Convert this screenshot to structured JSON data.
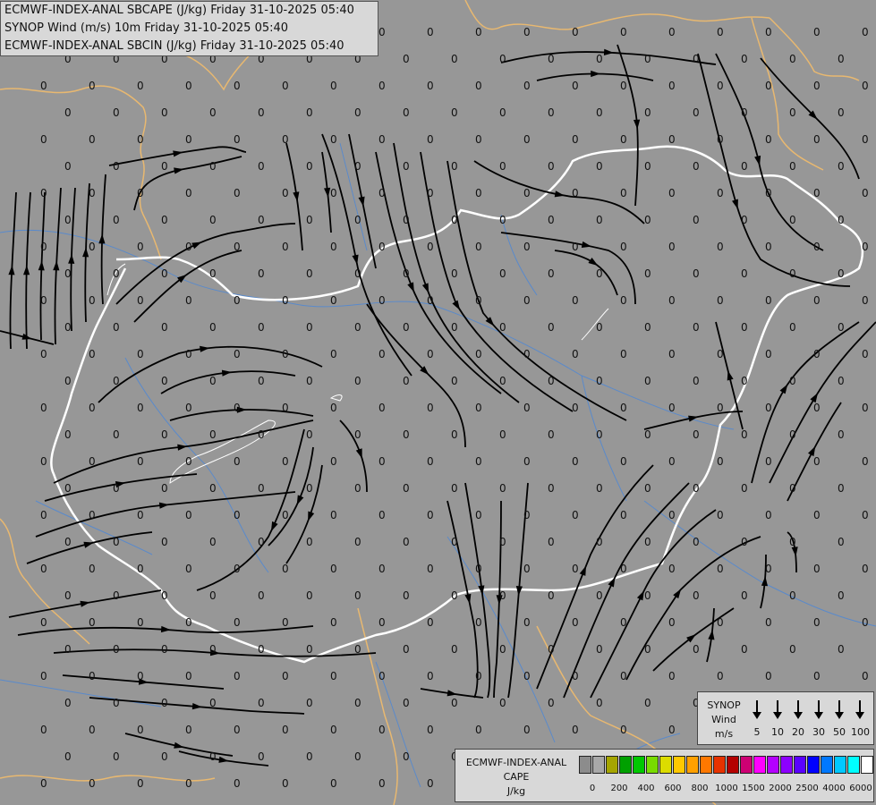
{
  "titles": {
    "line1": "ECMWF-INDEX-ANAL SBCAPE (J/kg) Friday 31-10-2025 05:40",
    "line2": "SYNOP Wind (m/s) 10m Friday 31-10-2025 05:40",
    "line3": "ECMWF-INDEX-ANAL SBCIN (J/kg) Friday 31-10-2025 05:40"
  },
  "wind_legend": {
    "title1": "SYNOP",
    "title2": "Wind",
    "unit": "m/s",
    "speeds": [
      "5",
      "10",
      "20",
      "30",
      "50",
      "100"
    ]
  },
  "cape_legend": {
    "title1": "ECMWF-INDEX-ANAL",
    "title2": "CAPE",
    "unit": "J/kg",
    "colors": [
      "#8c8c8c",
      "#a8a8a8",
      "#a5a500",
      "#00a000",
      "#00c800",
      "#78dc00",
      "#dcdc00",
      "#ffc800",
      "#ffa000",
      "#ff7800",
      "#e63200",
      "#b40000",
      "#cd0073",
      "#ff00ff",
      "#b400ff",
      "#8c00ff",
      "#5a00ff",
      "#0000ff",
      "#0078ff",
      "#00c8ff",
      "#00ffff",
      "#ffffff"
    ],
    "ticks": [
      "0",
      "200",
      "400",
      "600",
      "800",
      "1000",
      "1500",
      "2000",
      "2500",
      "4000",
      "6000"
    ]
  },
  "map": {
    "value_label": "0",
    "colors": {
      "background": "#979797",
      "country_border": "#e8b870",
      "national_border": "#ffffff",
      "rivers": "#5a8acb",
      "streamlines": "#000000"
    }
  }
}
